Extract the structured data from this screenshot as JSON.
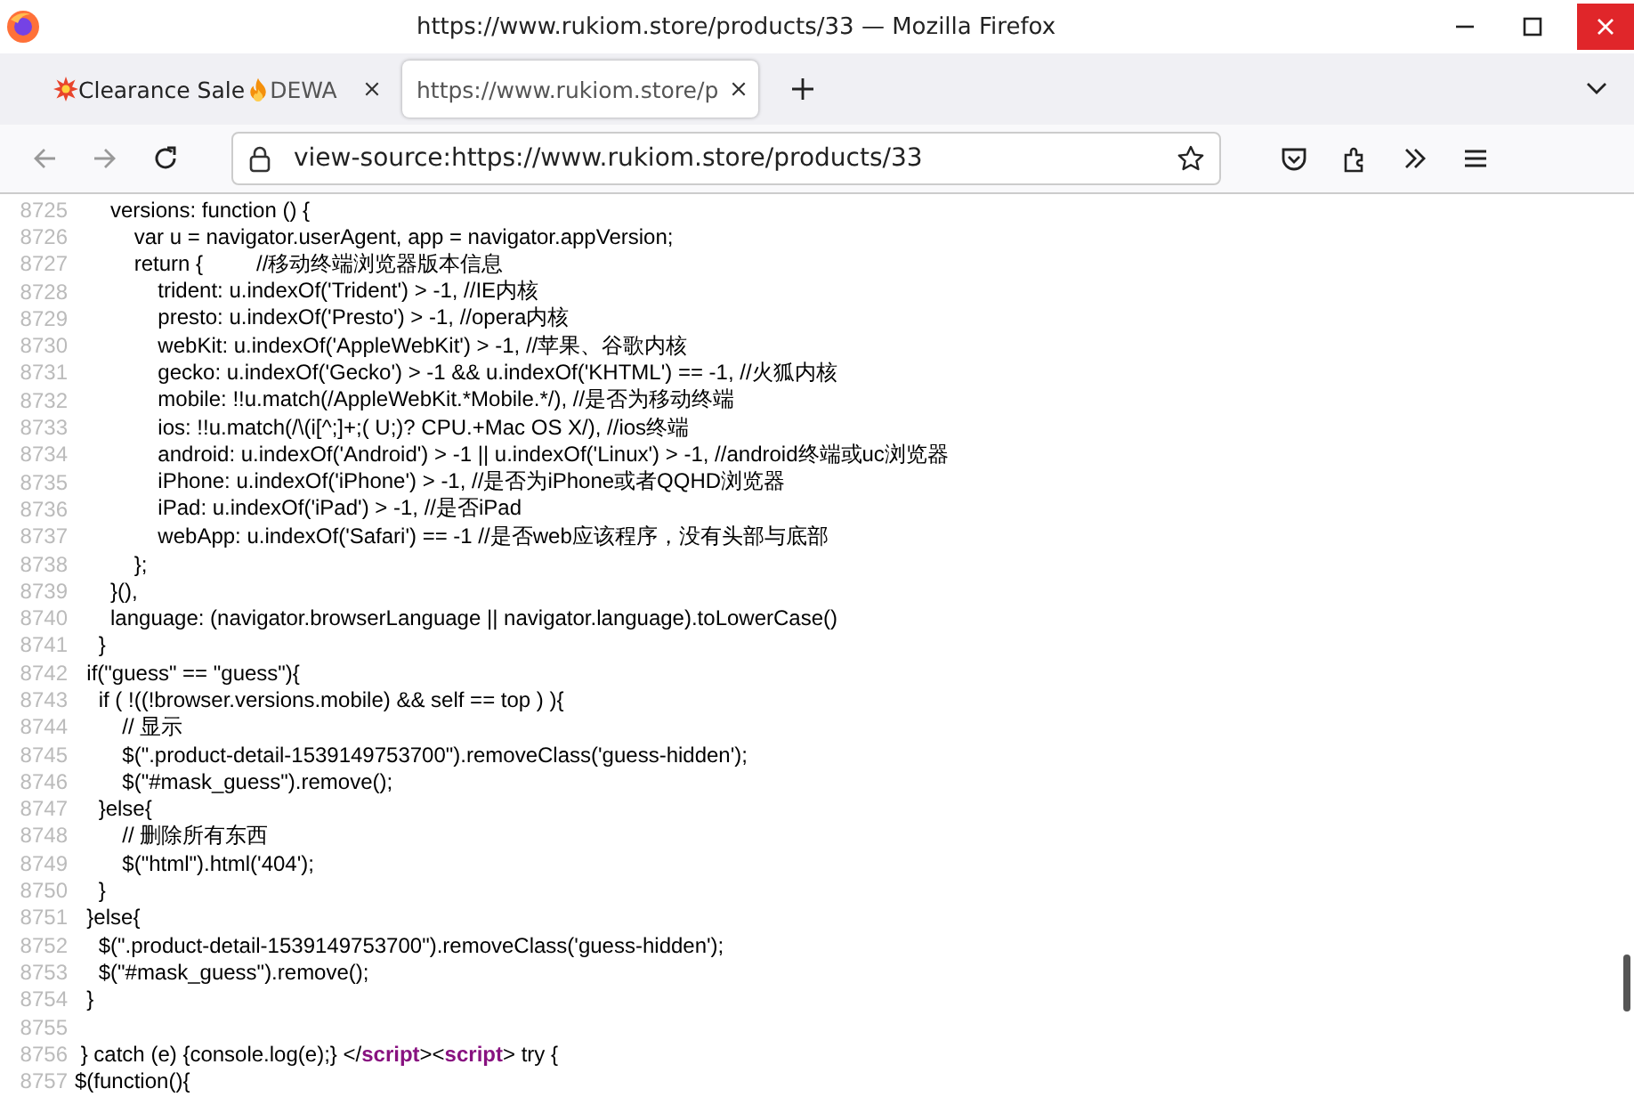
{
  "window": {
    "title": "https://www.rukiom.store/products/33 — Mozilla Firefox"
  },
  "tabs": [
    {
      "kind": "emoji",
      "label": "Clearance Sale",
      "label_2": "DEWA",
      "selected": false
    },
    {
      "kind": "plain",
      "label": "https://www.rukiom.store/p",
      "selected": true
    }
  ],
  "address_bar": {
    "value": "view-source:https://www.rukiom.store/products/33"
  },
  "source_lines": [
    {
      "number": "8725",
      "text": "      versions: function () {"
    },
    {
      "number": "8726",
      "text": "          var u = navigator.userAgent, app = navigator.appVersion;"
    },
    {
      "number": "8727",
      "text": "          return {         //移动终端浏览器版本信息"
    },
    {
      "number": "8728",
      "text": "              trident: u.indexOf('Trident') > -1, //IE内核"
    },
    {
      "number": "8729",
      "text": "              presto: u.indexOf('Presto') > -1, //opera内核"
    },
    {
      "number": "8730",
      "text": "              webKit: u.indexOf('AppleWebKit') > -1, //苹果、谷歌内核"
    },
    {
      "number": "8731",
      "text": "              gecko: u.indexOf('Gecko') > -1 && u.indexOf('KHTML') == -1, //火狐内核"
    },
    {
      "number": "8732",
      "text": "              mobile: !!u.match(/AppleWebKit.*Mobile.*/), //是否为移动终端"
    },
    {
      "number": "8733",
      "text": "              ios: !!u.match(/\\(i[^;]+;( U;)? CPU.+Mac OS X/), //ios终端"
    },
    {
      "number": "8734",
      "text": "              android: u.indexOf('Android') > -1 || u.indexOf('Linux') > -1, //android终端或uc浏览器"
    },
    {
      "number": "8735",
      "text": "              iPhone: u.indexOf('iPhone') > -1, //是否为iPhone或者QQHD浏览器"
    },
    {
      "number": "8736",
      "text": "              iPad: u.indexOf('iPad') > -1, //是否iPad"
    },
    {
      "number": "8737",
      "text": "              webApp: u.indexOf('Safari') == -1 //是否web应该程序，没有头部与底部"
    },
    {
      "number": "8738",
      "text": "          };"
    },
    {
      "number": "8739",
      "text": "      }(),"
    },
    {
      "number": "8740",
      "text": "      language: (navigator.browserLanguage || navigator.language).toLowerCase()"
    },
    {
      "number": "8741",
      "text": "    }"
    },
    {
      "number": "8742",
      "text": "  if(\"guess\" == \"guess\"){"
    },
    {
      "number": "8743",
      "text": "    if ( !((!browser.versions.mobile) && self == top ) ){"
    },
    {
      "number": "8744",
      "text": "        // 显示"
    },
    {
      "number": "8745",
      "text": "        $(\".product-detail-1539149753700\").removeClass('guess-hidden');"
    },
    {
      "number": "8746",
      "text": "        $(\"#mask_guess\").remove();"
    },
    {
      "number": "8747",
      "text": "    }else{"
    },
    {
      "number": "8748",
      "text": "        // 删除所有东西"
    },
    {
      "number": "8749",
      "text": "        $(\"html\").html('404');"
    },
    {
      "number": "8750",
      "text": "    }"
    },
    {
      "number": "8751",
      "text": "  }else{"
    },
    {
      "number": "8752",
      "text": "    $(\".product-detail-1539149753700\").removeClass('guess-hidden');"
    },
    {
      "number": "8753",
      "text": "    $(\"#mask_guess\").remove();"
    },
    {
      "number": "8754",
      "text": "  }"
    },
    {
      "number": "8755"
    },
    {
      "number": "8756",
      "kind": "markup",
      "text": " } catch (e) {console.log(e);} </**script**><**script**> try {"
    },
    {
      "number": "8757",
      "text": "$(function(){"
    }
  ]
}
